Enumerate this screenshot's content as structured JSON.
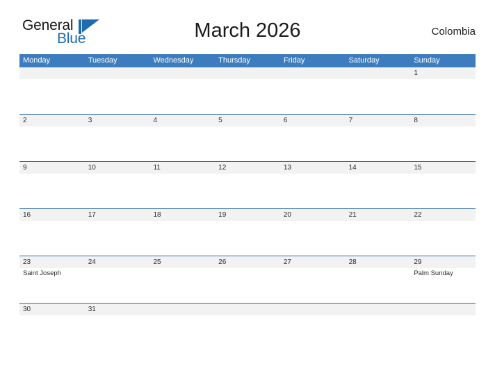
{
  "brand": {
    "name_part1": "General",
    "name_part2": "Blue",
    "mark": "triangle-flag-icon",
    "color_primary": "#1f6bb0",
    "color_text": "#1a1a1a"
  },
  "header": {
    "title": "March 2026",
    "country": "Colombia"
  },
  "theme": {
    "header_blue": "#3d7dbf",
    "row_border_blue": "#2e6da4",
    "date_band_gray": "#f2f2f2",
    "page_background": "#ffffff"
  },
  "calendar": {
    "weekday_headers": [
      "Monday",
      "Tuesday",
      "Wednesday",
      "Thursday",
      "Friday",
      "Saturday",
      "Sunday"
    ],
    "weeks": [
      {
        "days": [
          {
            "date": "",
            "events": []
          },
          {
            "date": "",
            "events": []
          },
          {
            "date": "",
            "events": []
          },
          {
            "date": "",
            "events": []
          },
          {
            "date": "",
            "events": []
          },
          {
            "date": "",
            "events": []
          },
          {
            "date": "1",
            "events": []
          }
        ]
      },
      {
        "days": [
          {
            "date": "2",
            "events": []
          },
          {
            "date": "3",
            "events": []
          },
          {
            "date": "4",
            "events": []
          },
          {
            "date": "5",
            "events": []
          },
          {
            "date": "6",
            "events": []
          },
          {
            "date": "7",
            "events": []
          },
          {
            "date": "8",
            "events": []
          }
        ]
      },
      {
        "days": [
          {
            "date": "9",
            "events": []
          },
          {
            "date": "10",
            "events": []
          },
          {
            "date": "11",
            "events": []
          },
          {
            "date": "12",
            "events": []
          },
          {
            "date": "13",
            "events": []
          },
          {
            "date": "14",
            "events": []
          },
          {
            "date": "15",
            "events": []
          }
        ]
      },
      {
        "days": [
          {
            "date": "16",
            "events": []
          },
          {
            "date": "17",
            "events": []
          },
          {
            "date": "18",
            "events": []
          },
          {
            "date": "19",
            "events": []
          },
          {
            "date": "20",
            "events": []
          },
          {
            "date": "21",
            "events": []
          },
          {
            "date": "22",
            "events": []
          }
        ]
      },
      {
        "days": [
          {
            "date": "23",
            "events": [
              "Saint Joseph"
            ]
          },
          {
            "date": "24",
            "events": []
          },
          {
            "date": "25",
            "events": []
          },
          {
            "date": "26",
            "events": []
          },
          {
            "date": "27",
            "events": []
          },
          {
            "date": "28",
            "events": []
          },
          {
            "date": "29",
            "events": [
              "Palm Sunday"
            ]
          }
        ]
      },
      {
        "days": [
          {
            "date": "30",
            "events": []
          },
          {
            "date": "31",
            "events": []
          },
          {
            "date": "",
            "events": []
          },
          {
            "date": "",
            "events": []
          },
          {
            "date": "",
            "events": []
          },
          {
            "date": "",
            "events": []
          },
          {
            "date": "",
            "events": []
          }
        ]
      }
    ]
  }
}
